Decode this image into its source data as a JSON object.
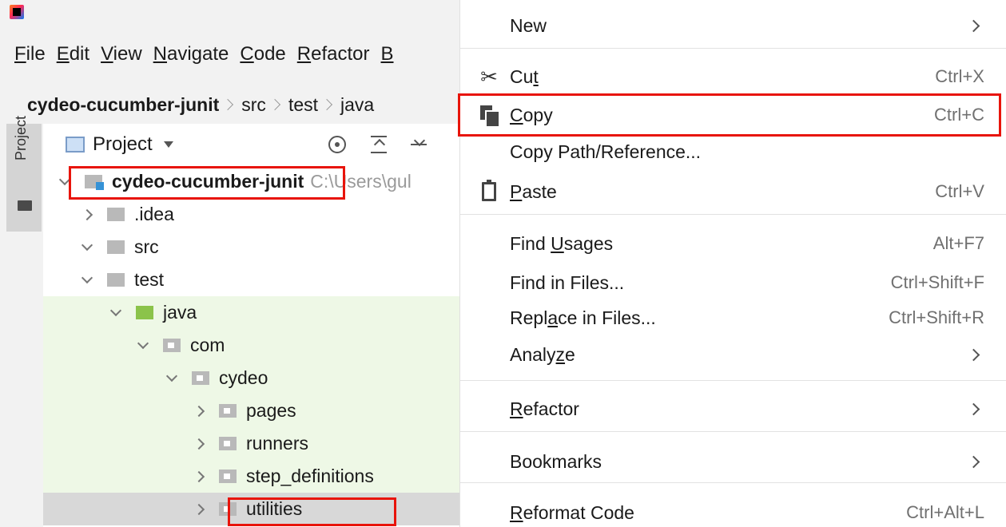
{
  "menubar": {
    "items": [
      {
        "label": "File",
        "m": "F",
        "rest": "ile"
      },
      {
        "label": "Edit",
        "m": "E",
        "rest": "dit"
      },
      {
        "label": "View",
        "m": "V",
        "rest": "iew"
      },
      {
        "label": "Navigate",
        "m": "N",
        "rest": "avigate"
      },
      {
        "label": "Code",
        "m": "C",
        "rest": "ode"
      },
      {
        "label": "Refactor",
        "m": "R",
        "rest": "efactor"
      },
      {
        "label": "B",
        "m": "B",
        "rest": ""
      }
    ]
  },
  "breadcrumb": [
    "cydeo-cucumber-junit",
    "src",
    "test",
    "java"
  ],
  "tool_window": {
    "stripe_label": "Project"
  },
  "project_panel": {
    "title": "Project",
    "tree": [
      {
        "label": "cydeo-cucumber-junit",
        "path": "C:\\Users\\gul",
        "level": 0,
        "expanded": true,
        "bold": true,
        "icon": "module-folder-icon"
      },
      {
        "label": ".idea",
        "level": 1,
        "expanded": false,
        "icon": "folder-icon"
      },
      {
        "label": "src",
        "level": 1,
        "expanded": true,
        "icon": "folder-icon"
      },
      {
        "label": "test",
        "level": 2,
        "expanded": true,
        "icon": "folder-icon"
      },
      {
        "label": "java",
        "level": 3,
        "expanded": true,
        "icon": "source-folder-icon"
      },
      {
        "label": "com",
        "level": 4,
        "expanded": true,
        "icon": "package-icon"
      },
      {
        "label": "cydeo",
        "level": 5,
        "expanded": true,
        "icon": "package-icon"
      },
      {
        "label": "pages",
        "level": 6,
        "expanded": false,
        "icon": "package-icon"
      },
      {
        "label": "runners",
        "level": 6,
        "expanded": false,
        "icon": "package-icon"
      },
      {
        "label": "step_definitions",
        "level": 6,
        "expanded": false,
        "icon": "package-icon"
      },
      {
        "label": "utilities",
        "level": 6,
        "expanded": false,
        "icon": "package-icon"
      }
    ]
  },
  "context_menu": {
    "items": [
      {
        "label": "New",
        "m_pre": "New",
        "m": "",
        "m_post": "",
        "shortcut": "",
        "submenu": true,
        "icon": ""
      },
      {
        "label": "Cut",
        "m_pre": "Cu",
        "m": "t",
        "m_post": "",
        "shortcut": "Ctrl+X",
        "submenu": false,
        "icon": "scissors-icon"
      },
      {
        "label": "Copy",
        "m_pre": "",
        "m": "C",
        "m_post": "opy",
        "shortcut": "Ctrl+C",
        "submenu": false,
        "icon": "copy-icon"
      },
      {
        "label": "Copy Path/Reference...",
        "m_pre": "Copy Path/Reference...",
        "m": "",
        "m_post": "",
        "shortcut": "",
        "submenu": false,
        "icon": ""
      },
      {
        "label": "Paste",
        "m_pre": "",
        "m": "P",
        "m_post": "aste",
        "shortcut": "Ctrl+V",
        "submenu": false,
        "icon": "paste-icon"
      },
      {
        "label": "Find Usages",
        "m_pre": "Find ",
        "m": "U",
        "m_post": "sages",
        "shortcut": "Alt+F7",
        "submenu": false,
        "icon": ""
      },
      {
        "label": "Find in Files...",
        "m_pre": "Find in Files...",
        "m": "",
        "m_post": "",
        "shortcut": "Ctrl+Shift+F",
        "submenu": false,
        "icon": ""
      },
      {
        "label": "Replace in Files...",
        "m_pre": "Repl",
        "m": "a",
        "m_post": "ce in Files...",
        "shortcut": "Ctrl+Shift+R",
        "submenu": false,
        "icon": ""
      },
      {
        "label": "Analyze",
        "m_pre": "Analy",
        "m": "z",
        "m_post": "e",
        "shortcut": "",
        "submenu": true,
        "icon": ""
      },
      {
        "label": "Refactor",
        "m_pre": "",
        "m": "R",
        "m_post": "efactor",
        "shortcut": "",
        "submenu": true,
        "icon": ""
      },
      {
        "label": "Bookmarks",
        "m_pre": "Bookmarks",
        "m": "",
        "m_post": "",
        "shortcut": "",
        "submenu": true,
        "icon": ""
      },
      {
        "label": "Reformat Code",
        "m_pre": "",
        "m": "R",
        "m_post": "eformat Code",
        "shortcut": "Ctrl+Alt+L",
        "submenu": false,
        "icon": ""
      }
    ]
  },
  "colors": {
    "highlight_box": "#e8140b",
    "java_source_bg": "#eef8e6",
    "selected_row": "#d8d8d8",
    "source_folder": "#8bc34a"
  }
}
